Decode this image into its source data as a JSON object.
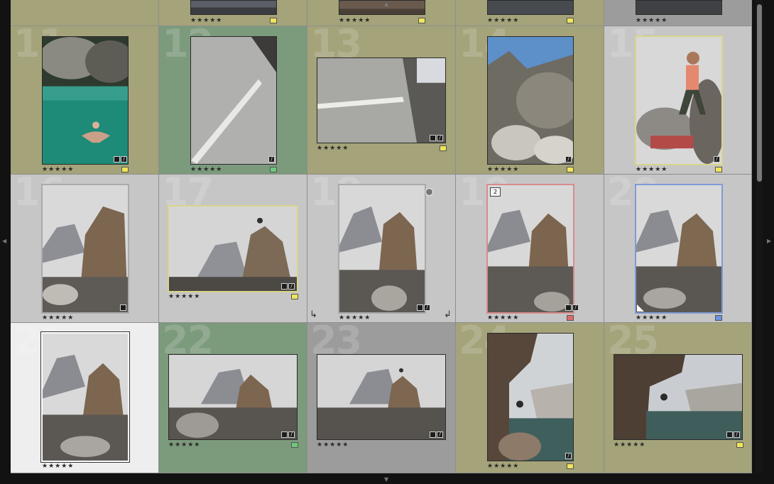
{
  "prev_row_stars": [
    "★★★★★",
    "★★★★★",
    "★★★★★",
    "★★★★★",
    "★★★★★"
  ],
  "cells": [
    {
      "index": "11",
      "stars": "★★★★★"
    },
    {
      "index": "12",
      "stars": "★★★★★"
    },
    {
      "index": "13",
      "stars": "★★★★★"
    },
    {
      "index": "14",
      "stars": "★★★★★"
    },
    {
      "index": "15",
      "stars": "★★★★★"
    },
    {
      "index": "16",
      "stars": "★★★★★"
    },
    {
      "index": "17",
      "stars": "★★★★★"
    },
    {
      "index": "18",
      "stars": "★★★★★"
    },
    {
      "index": "19",
      "stars": "★★★★★",
      "stack_count": "2"
    },
    {
      "index": "20",
      "stars": "★★★★★"
    },
    {
      "index": "21",
      "stars": "★★★★★"
    },
    {
      "index": "22",
      "stars": "★★★★★"
    },
    {
      "index": "23",
      "stars": "★★★★★"
    },
    {
      "index": "24",
      "stars": "★★★★★"
    },
    {
      "index": "25",
      "stars": "★★★★★"
    }
  ],
  "colors": {
    "label_yellow": "#efe55a",
    "label_green": "#6fc97a",
    "label_red": "#e06a6a",
    "label_blue": "#6b93e0",
    "cell_yellow": "#a4a37a",
    "cell_green": "#7c9a7c",
    "cell_grey": "#c6c6c6",
    "cell_dark": "#9c9c9c",
    "cell_selected": "#eeeeee"
  },
  "icons": [
    "badge-crop-icon",
    "badge-develop-icon",
    "stack-return-icon",
    "edge-arrow-icon"
  ]
}
